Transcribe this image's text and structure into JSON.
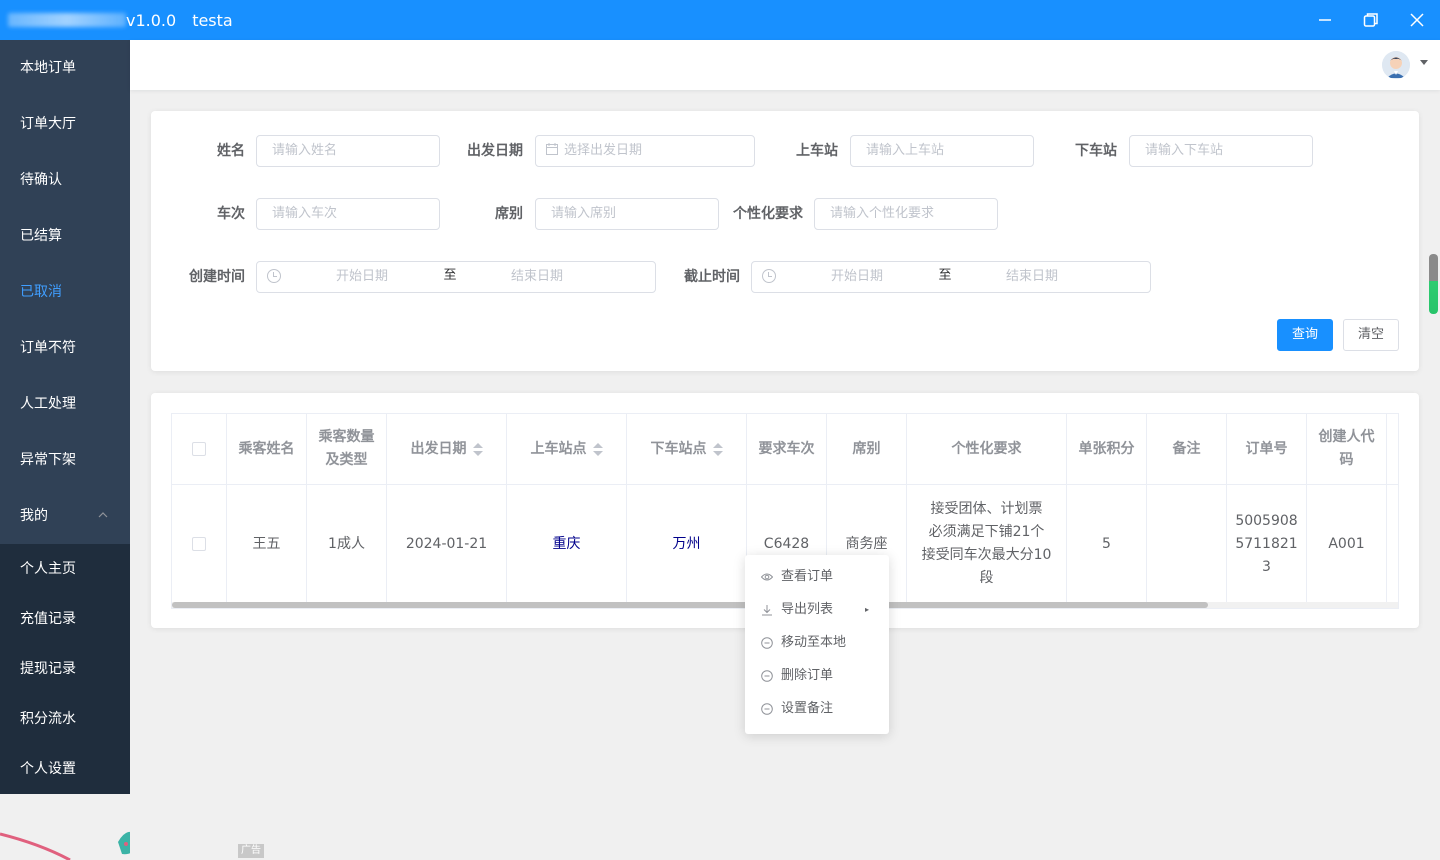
{
  "window": {
    "version": "v1.0.0",
    "app_name": "testa"
  },
  "sidebar": {
    "items": [
      {
        "label": "本地订单"
      },
      {
        "label": "订单大厅"
      },
      {
        "label": "待确认"
      },
      {
        "label": "已结算"
      },
      {
        "label": "已取消",
        "active": true
      },
      {
        "label": "订单不符"
      },
      {
        "label": "人工处理"
      },
      {
        "label": "异常下架"
      }
    ],
    "group": {
      "label": "我的",
      "expanded": true,
      "children": [
        {
          "label": "个人主页"
        },
        {
          "label": "充值记录"
        },
        {
          "label": "提现记录"
        },
        {
          "label": "积分流水"
        },
        {
          "label": "个人设置"
        }
      ]
    }
  },
  "search": {
    "name": {
      "label": "姓名",
      "placeholder": "请输入姓名"
    },
    "depart_date": {
      "label": "出发日期",
      "placeholder": "选择出发日期"
    },
    "board_station": {
      "label": "上车站",
      "placeholder": "请输入上车站"
    },
    "alight_station": {
      "label": "下车站",
      "placeholder": "请输入下车站"
    },
    "train": {
      "label": "车次",
      "placeholder": "请输入车次"
    },
    "seat": {
      "label": "席别",
      "placeholder": "请输入席别"
    },
    "custom": {
      "label": "个性化要求",
      "placeholder": "请输入个性化要求"
    },
    "created": {
      "label": "创建时间",
      "start": "开始日期",
      "sep": "至",
      "end": "结束日期"
    },
    "deadline": {
      "label": "截止时间",
      "start": "开始日期",
      "sep": "至",
      "end": "结束日期"
    },
    "query_button": "查询",
    "clear_button": "清空"
  },
  "table": {
    "headers": [
      "乘客姓名",
      "乘客数量及类型",
      "出发日期",
      "上车站点",
      "下车站点",
      "要求车次",
      "席别",
      "个性化要求",
      "单张积分",
      "备注",
      "订单号",
      "创建人代码"
    ],
    "header_lines": {
      "count_type": [
        "乘客数量",
        "及类型"
      ],
      "creator": [
        "创建人代",
        "码"
      ]
    },
    "rows": [
      {
        "name": "王五",
        "count_type": "1成人",
        "depart_date": "2024-01-21",
        "board": "重庆",
        "alight": "万州",
        "train": "C6428",
        "seat": "商务座",
        "custom": "接受团体、计划票必须满足下铺21个接受同车次最大分10段",
        "points": "5",
        "remark": "",
        "order_no": "50059085711821 3",
        "order_no_lines": [
          "5005908",
          "5711821",
          "3"
        ],
        "custom_lines": [
          "接受团体、计划票",
          "必须满足下铺21个",
          "接受同车次最大分10",
          "段"
        ],
        "creator": "A001"
      }
    ]
  },
  "context_menu": {
    "items": [
      {
        "label": "查看订单",
        "icon": "eye-icon"
      },
      {
        "label": "导出列表",
        "icon": "download-icon",
        "has_submenu": true
      },
      {
        "label": "移动至本地",
        "icon": "minus-circle-icon"
      },
      {
        "label": "删除订单",
        "icon": "minus-circle-icon"
      },
      {
        "label": "设置备注",
        "icon": "minus-circle-icon"
      }
    ]
  },
  "ad_label": "广告",
  "colors": {
    "titlebar": "#1890ff",
    "sidebar": "#304156",
    "submenu": "#1f2d3d",
    "active": "#409eff",
    "primary": "#1890ff",
    "station_link": "#00008b"
  }
}
